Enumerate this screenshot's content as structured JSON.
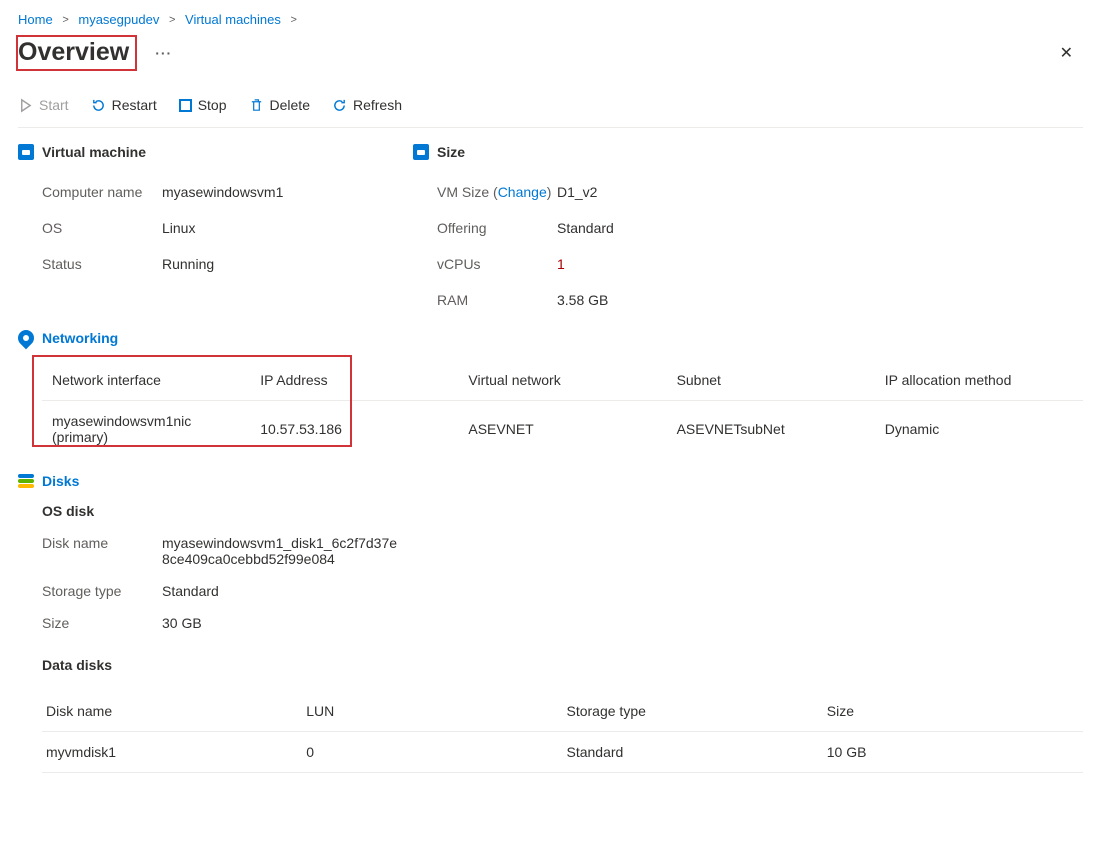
{
  "breadcrumb": {
    "home": "Home",
    "resource": "myasegpudev",
    "vms": "Virtual machines"
  },
  "page_title": "Overview",
  "toolbar": {
    "start": "Start",
    "restart": "Restart",
    "stop": "Stop",
    "delete": "Delete",
    "refresh": "Refresh"
  },
  "sections": {
    "virtual_machine": {
      "title": "Virtual machine",
      "computer_name_label": "Computer name",
      "computer_name_value": "myasewindowsvm1",
      "os_label": "OS",
      "os_value": "Linux",
      "status_label": "Status",
      "status_value": "Running"
    },
    "size": {
      "title": "Size",
      "vm_size_label": "VM Size (",
      "vm_size_change": "Change",
      "vm_size_label_close": ")",
      "vm_size_value": "D1_v2",
      "offering_label": "Offering",
      "offering_value": "Standard",
      "vcpus_label": "vCPUs",
      "vcpus_value": "1",
      "ram_label": "RAM",
      "ram_value": "3.58 GB"
    },
    "networking": {
      "title": "Networking",
      "headers": {
        "nic": "Network interface",
        "ip": "IP Address",
        "vnet": "Virtual network",
        "subnet": "Subnet",
        "alloc": "IP allocation method"
      },
      "row": {
        "nic": "myasewindowsvm1nic (primary)",
        "ip": "10.57.53.186",
        "vnet": "ASEVNET",
        "subnet": "ASEVNETsubNet",
        "alloc": "Dynamic"
      }
    },
    "disks": {
      "title": "Disks",
      "os_disk_header": "OS disk",
      "disk_name_label": "Disk name",
      "disk_name_value": "myasewindowsvm1_disk1_6c2f7d37e8ce409ca0cebbd52f99e084",
      "storage_type_label": "Storage type",
      "storage_type_value": "Standard",
      "size_label": "Size",
      "size_value": "30 GB",
      "data_disks_header": "Data disks",
      "headers": {
        "name": "Disk name",
        "lun": "LUN",
        "storage": "Storage type",
        "size": "Size"
      },
      "row": {
        "name": "myvmdisk1",
        "lun": "0",
        "storage": "Standard",
        "size": "10 GB"
      }
    }
  }
}
